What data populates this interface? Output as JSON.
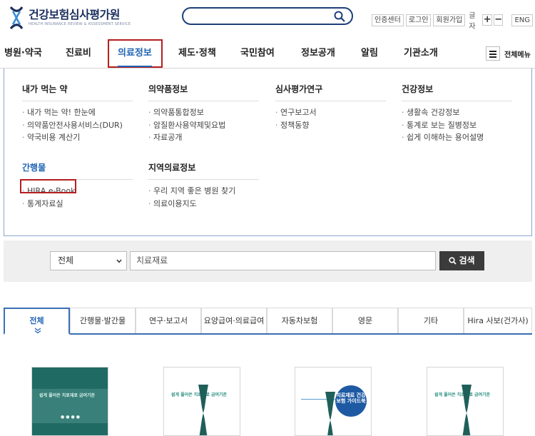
{
  "header": {
    "logo_name": "건강보험심사평가원",
    "logo_sub": "HEALTH INSURANCE REVIEW & ASSESSMENT SERVICE",
    "search_placeholder": "",
    "util": {
      "cert": "인증센터",
      "login": "로그인",
      "join": "회원가입",
      "font_label": "글자",
      "zoom_in": "+",
      "zoom_out": "−",
      "eng": "ENG"
    }
  },
  "nav": {
    "items": [
      "병원·약국",
      "진료비",
      "의료정보",
      "제도·정책",
      "국민참여",
      "정보공개",
      "알림",
      "기관소개"
    ],
    "active_index": 2,
    "all_menu": "전체메뉴"
  },
  "mega": {
    "columns": [
      {
        "title": "내가 먹는 약",
        "items": [
          "내가 먹는 약! 한눈에",
          "의약품안전사용서비스(DUR)",
          "약국비용 계산기"
        ]
      },
      {
        "title": "의약품정보",
        "items": [
          "의약품통합정보",
          "암질환사용약제및요법",
          "자료공개"
        ]
      },
      {
        "title": "심사평가연구",
        "items": [
          "연구보고서",
          "정책동향"
        ]
      },
      {
        "title": "건강정보",
        "items": [
          "생활속 건강정보",
          "통계로 보는 질병정보",
          "쉽게 이해하는 용어설명"
        ]
      },
      {
        "title": "간행물",
        "items": [
          "HIRA e-Book",
          "통계자료실"
        ]
      },
      {
        "title": "지역의료정보",
        "items": [
          "우리 지역 좋은 병원 찾기",
          "의료이용지도"
        ]
      }
    ]
  },
  "search": {
    "select_value": "전체",
    "keyword": "치료재료",
    "button": "검색"
  },
  "tabs": {
    "items": [
      "전체",
      "간행물·발간물",
      "연구·보고서",
      "요양급여·의료급여",
      "자동차보험",
      "영문",
      "기타",
      "Hira 사보(건가사)"
    ],
    "active_index": 0
  },
  "books": {
    "b1_title": "쉽게 풀어쓴 치료재료 급여기준",
    "b2_title": "쉽게 풀어쓴 치료재료 급여기준",
    "b3_badge": "치료재료 건강보험 가이드북",
    "b4_title": "쉽게 풀어쓴 치료재료 급여기준"
  },
  "colors": {
    "primary": "#1f63b4",
    "highlight": "#b41f1f",
    "navy": "#1b2f5e"
  }
}
